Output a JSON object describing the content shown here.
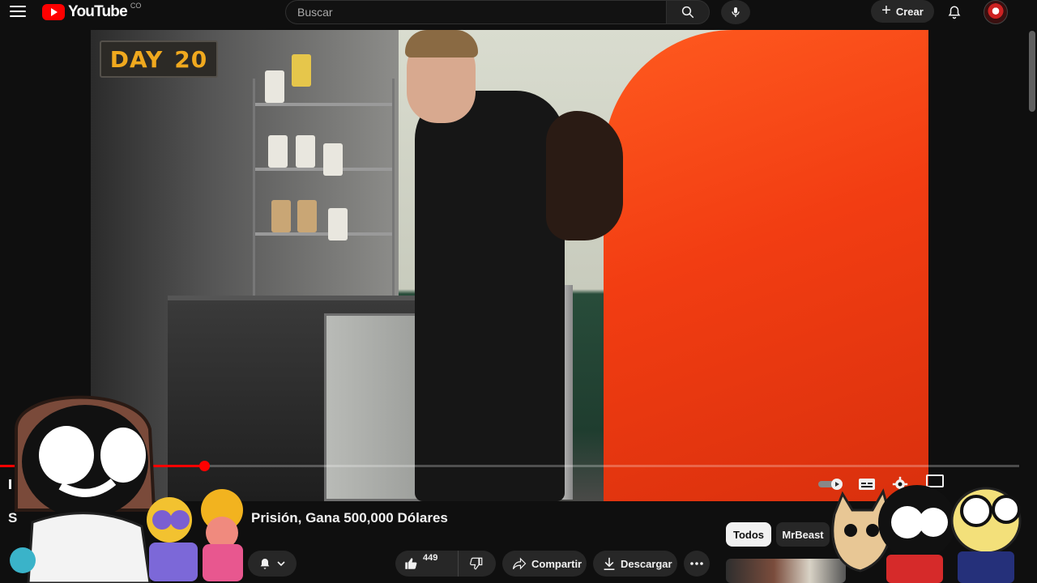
{
  "header": {
    "logo_text": "YouTube",
    "logo_country": "CO",
    "search_placeholder": "Buscar",
    "create_label": "Crear"
  },
  "video": {
    "overlay_day_word": "DAY",
    "overlay_day_number": "20",
    "progress": 0.2,
    "title_prefix": "S",
    "title": "Prisión, Gana 500,000 Dólares"
  },
  "actions": {
    "like_count": "449",
    "share_label": "Compartir",
    "download_label": "Descargar"
  },
  "chips": [
    {
      "label": "Todos",
      "selected": true
    },
    {
      "label": "MrBeast",
      "selected": false
    }
  ],
  "colors": {
    "brand": "#ff0000",
    "background": "#0f0f0f",
    "chip_selected_bg": "#f1f1f1",
    "jumpsuit": "#f23d12"
  },
  "icons": [
    "menu-icon",
    "youtube-logo-icon",
    "search-icon",
    "mic-icon",
    "plus-icon",
    "bell-icon",
    "play-icon",
    "autoplay-toggle-icon",
    "subtitles-icon",
    "settings-icon",
    "fullscreen-icon",
    "like-icon",
    "dislike-icon",
    "share-icon",
    "download-icon",
    "more-icon",
    "bell-subscribed-icon",
    "chevron-down-icon"
  ]
}
